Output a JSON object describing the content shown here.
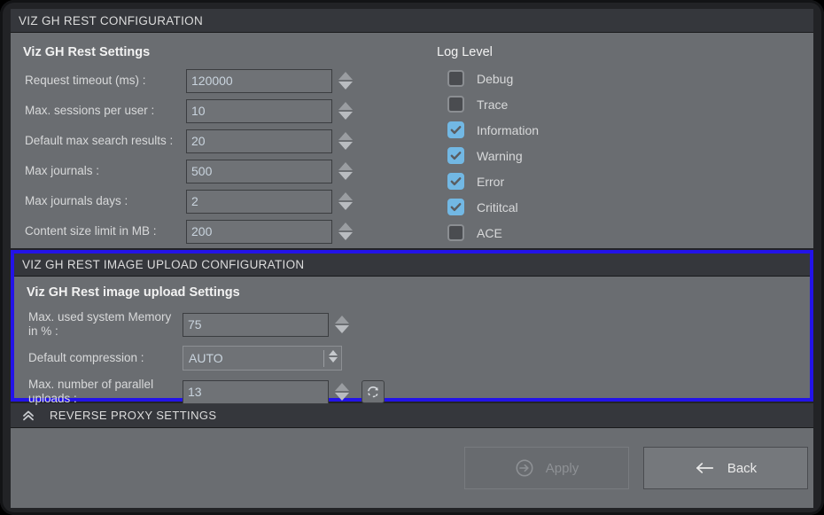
{
  "window": {
    "title": "VIZ GH REST CONFIGURATION"
  },
  "main_settings": {
    "group_title": "Viz GH Rest Settings",
    "fields": [
      {
        "label": "Request timeout (ms) :",
        "value": "120000"
      },
      {
        "label": "Max. sessions per user :",
        "value": "10"
      },
      {
        "label": "Default max search results :",
        "value": "20"
      },
      {
        "label": "Max journals :",
        "value": "500"
      },
      {
        "label": "Max journals days :",
        "value": "2"
      },
      {
        "label": "Content size limit in MB :",
        "value": "200"
      }
    ]
  },
  "log_level": {
    "title": "Log Level",
    "items": [
      {
        "label": "Debug",
        "checked": false
      },
      {
        "label": "Trace",
        "checked": false
      },
      {
        "label": "Information",
        "checked": true
      },
      {
        "label": "Warning",
        "checked": true
      },
      {
        "label": "Error",
        "checked": true
      },
      {
        "label": "Crititcal",
        "checked": true
      },
      {
        "label": "ACE",
        "checked": false
      }
    ]
  },
  "image_upload": {
    "header": "VIZ GH REST IMAGE UPLOAD CONFIGURATION",
    "group_title": "Viz GH Rest image upload Settings",
    "memory_label": "Max. used system Memory in % :",
    "memory_value": "75",
    "compression_label": "Default compression :",
    "compression_value": "AUTO",
    "parallel_label": "Max. number of parallel uploads :",
    "parallel_value": "13",
    "border_color": "#2313e8"
  },
  "reverse_proxy": {
    "label": "REVERSE PROXY SETTINGS"
  },
  "footer": {
    "apply_label": "Apply",
    "back_label": "Back"
  }
}
